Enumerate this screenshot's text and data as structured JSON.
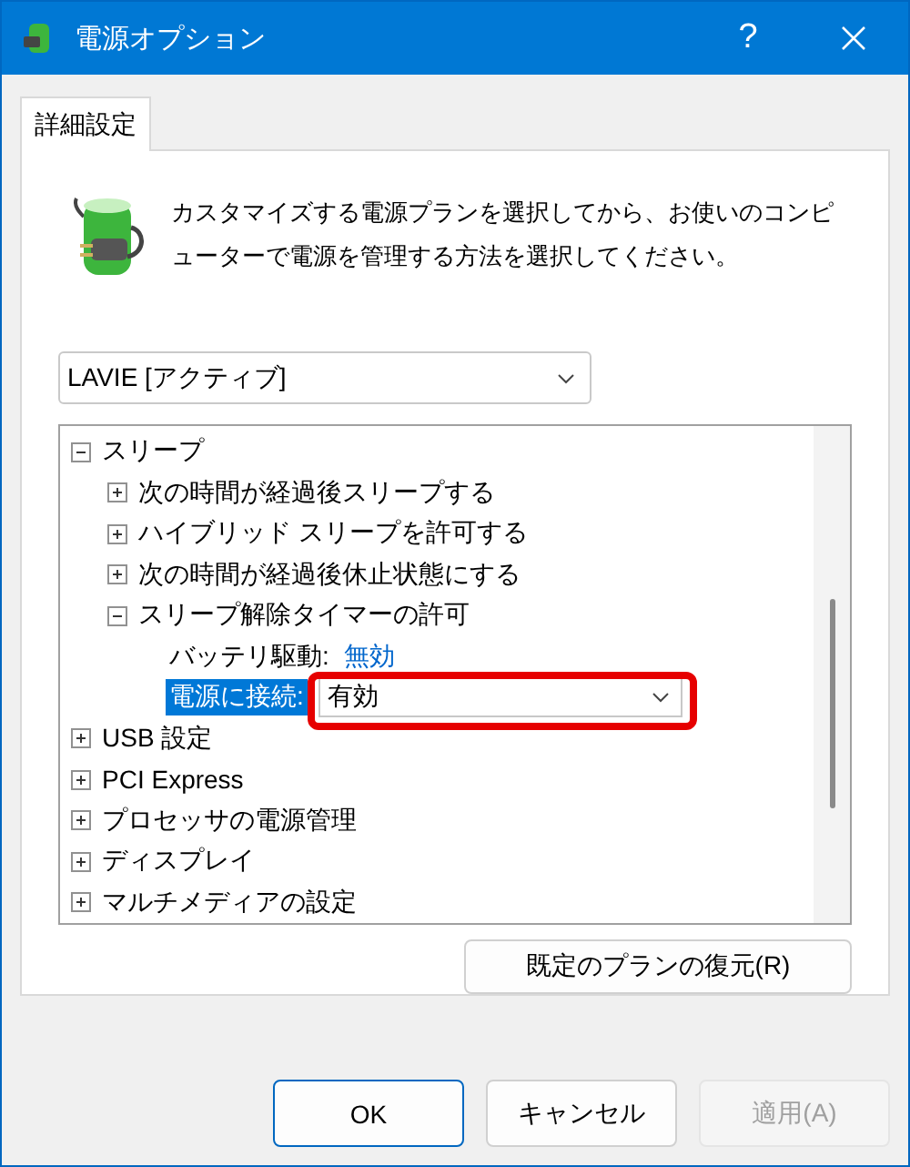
{
  "window": {
    "title": "電源オプション",
    "help": "?"
  },
  "tabs": [
    {
      "label": "詳細設定",
      "selected": true
    }
  ],
  "description": "カスタマイズする電源プランを選択してから、お使いのコンピューターで電源を管理する方法を選択してください。",
  "plan_select": {
    "value": "LAVIE [アクティブ]"
  },
  "tree": [
    {
      "kind": "group",
      "label": "スリープ",
      "expanded": true,
      "children": [
        {
          "kind": "group",
          "label": "次の時間が経過後スリープする",
          "expanded": false
        },
        {
          "kind": "group",
          "label": "ハイブリッド スリープを許可する",
          "expanded": false
        },
        {
          "kind": "group",
          "label": "次の時間が経過後休止状態にする",
          "expanded": false
        },
        {
          "kind": "group",
          "label": "スリープ解除タイマーの許可",
          "expanded": true,
          "children": [
            {
              "kind": "setting",
              "label": "バッテリ駆動:",
              "value": "無効",
              "selected": false
            },
            {
              "kind": "setting",
              "label": "電源に接続:",
              "value": "有効",
              "selected": true,
              "highlighted": true
            }
          ]
        }
      ]
    },
    {
      "kind": "group",
      "label": "USB 設定",
      "expanded": false
    },
    {
      "kind": "group",
      "label": "PCI Express",
      "expanded": false
    },
    {
      "kind": "group",
      "label": "プロセッサの電源管理",
      "expanded": false
    },
    {
      "kind": "group",
      "label": "ディスプレイ",
      "expanded": false
    },
    {
      "kind": "group",
      "label": "マルチメディアの設定",
      "expanded": false
    }
  ],
  "restore_button": "既定のプランの復元(R)",
  "buttons": [
    {
      "label": "OK",
      "default": true,
      "disabled": false
    },
    {
      "label": "キャンセル",
      "default": false,
      "disabled": false
    },
    {
      "label": "適用(A)",
      "default": false,
      "disabled": true
    }
  ]
}
